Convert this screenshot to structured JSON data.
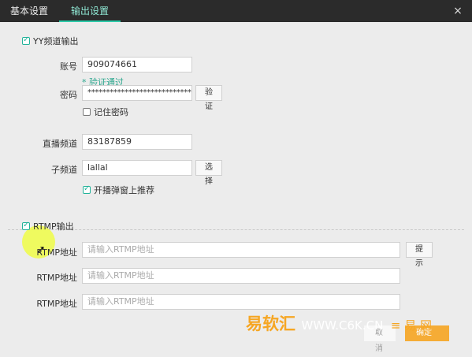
{
  "tabs": [
    {
      "label": "基本设置",
      "active": false
    },
    {
      "label": "输出设置",
      "active": true
    }
  ],
  "close_icon": "×",
  "yy_section": {
    "enabled_label": "YY频道输出",
    "account_label": "账号",
    "account_value": "909074661",
    "verified_text": "* 验证通过",
    "password_label": "密码",
    "password_value": "********************************",
    "verify_button": "验证",
    "remember_password_label": "记住密码",
    "live_channel_label": "直播频道",
    "live_channel_value": "83187859",
    "sub_channel_label": "子频道",
    "sub_channel_value": "lallal",
    "choose_button": "选择",
    "popup_recommend_label": "开播弹窗上推荐"
  },
  "rtmp_section": {
    "enabled_label": "RTMP输出",
    "address_label": "RTMP地址",
    "placeholder": "请输入RTMP地址",
    "hint_button": "提示"
  },
  "footer": {
    "cancel_label": "取消",
    "ok_label": "确定"
  },
  "watermark": {
    "text_1": "易软汇",
    "text_2": "WWW.C6K.CN",
    "text_3": "≡ 易 网"
  },
  "colors": {
    "accent": "#2ec9a8",
    "titlebar": "#2b2b2b",
    "background": "#ececec",
    "highlight": "#f0ff28",
    "watermark": "#f6a623"
  }
}
